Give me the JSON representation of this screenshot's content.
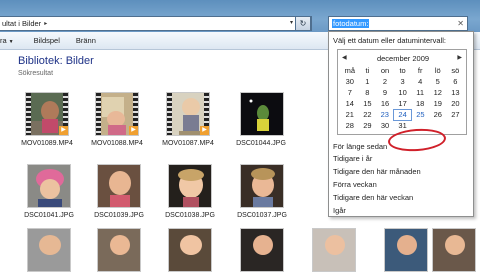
{
  "address": {
    "crumb": "ultat i Bilder"
  },
  "search": {
    "typed": "fotodatum:"
  },
  "toolbar": {
    "items": [
      "ra",
      "Bildspel",
      "Bränn"
    ]
  },
  "library": {
    "title": "Bibliotek: Bilder",
    "subtitle": "Sökresultat"
  },
  "row1": [
    "MOV01089.MP4",
    "MOV01088.MP4",
    "MOV01087.MP4",
    "DSC01044.JPG"
  ],
  "row2": [
    "DSC01041.JPG",
    "DSC01039.JPG",
    "DSC01038.JPG",
    "DSC01037.JPG"
  ],
  "datepicker": {
    "prompt": "Välj ett datum eller datumintervall:",
    "month": "december 2009",
    "days": [
      "må",
      "ti",
      "on",
      "to",
      "fr",
      "lö",
      "sö"
    ],
    "weeks": [
      [
        "30",
        "1",
        "2",
        "3",
        "4",
        "5",
        "6"
      ],
      [
        "7",
        "8",
        "9",
        "10",
        "11",
        "12",
        "13"
      ],
      [
        "14",
        "15",
        "16",
        "17",
        "18",
        "19",
        "20"
      ],
      [
        "21",
        "22",
        "23",
        "24",
        "25",
        "26",
        "27"
      ],
      [
        "28",
        "29",
        "30",
        "31",
        "",
        "",
        ""
      ]
    ],
    "options": [
      "För länge sedan",
      "Tidigare i år",
      "Tidigare den här månaden",
      "Förra veckan",
      "Tidigare den här veckan",
      "Igår"
    ]
  }
}
